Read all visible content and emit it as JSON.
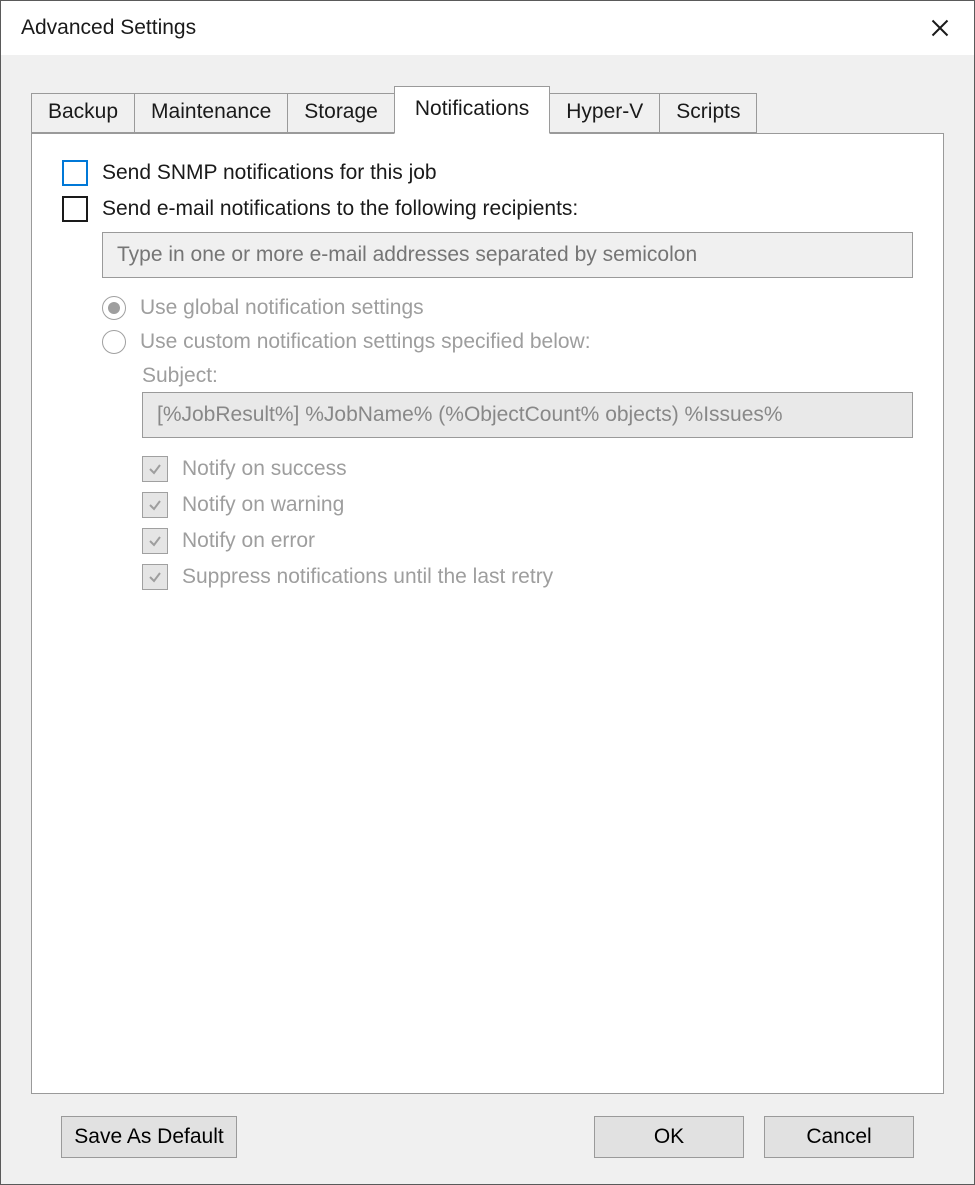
{
  "window": {
    "title": "Advanced Settings"
  },
  "tabs": {
    "backup": "Backup",
    "maintenance": "Maintenance",
    "storage": "Storage",
    "notifications": "Notifications",
    "hyperv": "Hyper-V",
    "scripts": "Scripts",
    "active": "notifications"
  },
  "notif": {
    "snmp_label": "Send SNMP notifications for this job",
    "email_label": "Send e-mail notifications to the following recipients:",
    "email_placeholder": "Type in one or more e-mail addresses separated by semicolon",
    "email_value": "",
    "radio_global": "Use global notification settings",
    "radio_custom": "Use custom notification settings specified below:",
    "subject_label": "Subject:",
    "subject_value": "[%JobResult%] %JobName% (%ObjectCount% objects) %Issues%",
    "notify_success": "Notify on success",
    "notify_warning": "Notify on warning",
    "notify_error": "Notify on error",
    "suppress": "Suppress notifications until the last retry"
  },
  "footer": {
    "save_default": "Save As Default",
    "ok": "OK",
    "cancel": "Cancel"
  }
}
